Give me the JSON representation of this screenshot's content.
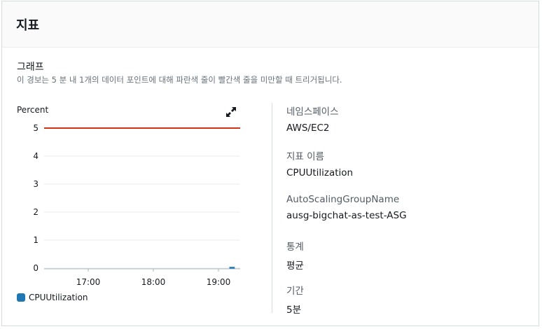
{
  "panel": {
    "title": "지표"
  },
  "graph": {
    "title": "그래프",
    "description": "이 경보는 5 분 내 1개의 데이터 포인트에 대해 파란색 줄이 빨간색 줄을 미만할 때 트리거됩니다.",
    "unit_label": "Percent",
    "expand_icon": "expand-arrows-icon"
  },
  "chart_data": {
    "type": "line",
    "ylim": [
      0,
      5
    ],
    "yticks": [
      "0",
      "1",
      "2",
      "3",
      "4",
      "5"
    ],
    "xticks": [
      "17:00",
      "18:00",
      "19:00"
    ],
    "grid": true,
    "threshold": {
      "value": 5,
      "color": "#d13212"
    },
    "series": [
      {
        "name": "CPUUtilization",
        "color": "#1f77b4",
        "x": [
          "19:10",
          "19:15"
        ],
        "y": [
          0,
          0
        ]
      }
    ],
    "legend_placement": "bottom-left"
  },
  "details": [
    {
      "label": "네임스페이스",
      "value": "AWS/EC2"
    },
    {
      "label": "지표 이름",
      "value": "CPUUtilization"
    },
    {
      "label": "AutoScalingGroupName",
      "value": "ausg-bigchat-as-test-ASG"
    },
    {
      "label": "통계",
      "value": "평균"
    },
    {
      "label": "기간",
      "value": "5분"
    }
  ]
}
